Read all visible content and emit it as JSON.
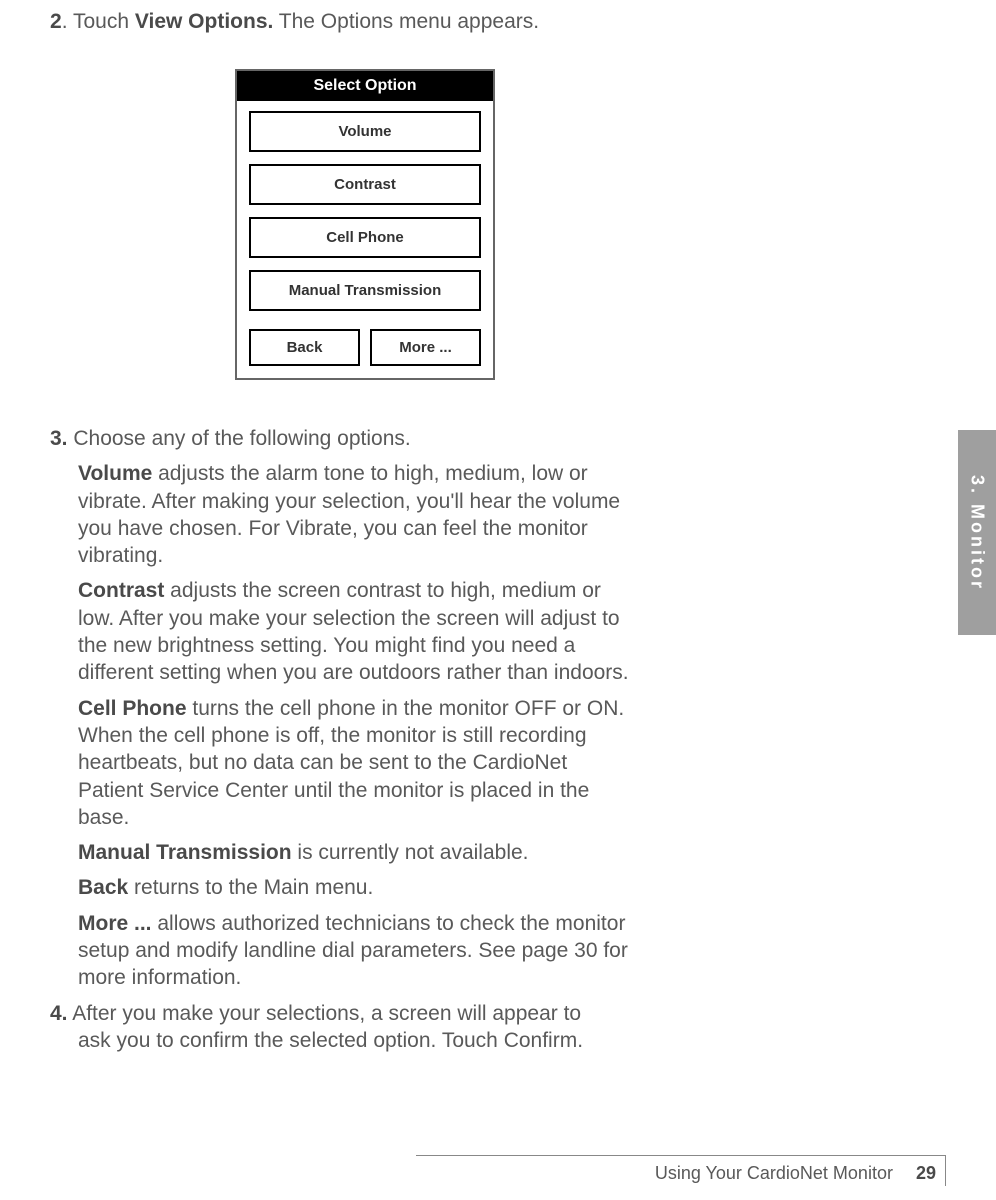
{
  "step2": {
    "num": "2",
    "pre": ". Touch ",
    "bold": "View Options.",
    "post": "  The Options menu appears."
  },
  "panel": {
    "title": "Select Option",
    "items": [
      "Volume",
      "Contrast",
      "Cell Phone",
      "Manual Transmission"
    ],
    "back": "Back",
    "more": "More ..."
  },
  "step3": {
    "num": "3.",
    "intro": " Choose any of the following options.",
    "volume": {
      "label": "Volume",
      "text": " adjusts the alarm tone to high, medium, low or vibrate. After making your selection, you'll hear the volume you have chosen. For Vibrate, you can feel the monitor vibrating."
    },
    "contrast": {
      "label": "Contrast",
      "text": " adjusts the screen contrast to high, medium or low. After you make your selection the screen will adjust to the new brightness setting. You might find you need a different setting when you are outdoors rather than indoors."
    },
    "cellphone": {
      "label": "Cell Phone",
      "text": " turns the cell phone in the monitor OFF or ON. When the cell phone is off, the monitor is still recording heartbeats, but no data can be sent to the CardioNet Patient Service Center until the monitor is placed in the base."
    },
    "manual": {
      "label": "Manual Transmission",
      "text": " is currently not available."
    },
    "back": {
      "label": "Back",
      "text": " returns to the Main menu."
    },
    "more": {
      "label": "More ...",
      "text": " allows authorized technicians to check the monitor setup and modify landline dial parameters. See page 30 for more information."
    }
  },
  "step4": {
    "num": "4.",
    "line1": " After you make your selections, a screen will appear to",
    "line2_pre": "ask you to confirm the selected option.  Touch ",
    "line2_bold": "Confirm",
    "line2_post": "."
  },
  "tab": "3.  Monitor",
  "footer": {
    "text": "Using Your CardioNet Monitor",
    "page": "29"
  }
}
